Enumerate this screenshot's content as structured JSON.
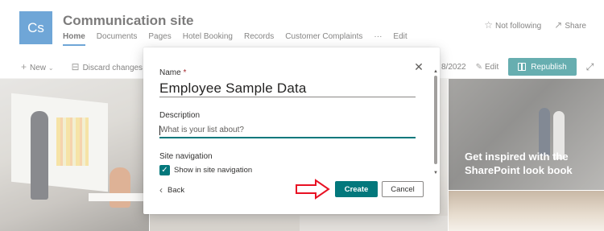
{
  "site": {
    "logo": "Cs",
    "title": "Communication site",
    "nav": [
      "Home",
      "Documents",
      "Pages",
      "Hotel Booking",
      "Records",
      "Customer Complaints",
      "···",
      "Edit"
    ],
    "not_following": "Not following",
    "share": "Share"
  },
  "commandbar": {
    "new": "New",
    "discard": "Discard changes",
    "date_fragment": "8/2022",
    "edit": "Edit",
    "republish": "Republish"
  },
  "hero": {
    "inspire_text": "Get inspired with the SharePoint look book"
  },
  "dialog": {
    "name_label": "Name",
    "required_mark": "*",
    "name_value": "Employee Sample Data",
    "description_label": "Description",
    "description_placeholder": "What is your list about?",
    "site_navigation_label": "Site navigation",
    "show_in_nav": "Show in site navigation",
    "show_in_nav_checked": true,
    "back": "Back",
    "create": "Create",
    "cancel": "Cancel"
  },
  "colors": {
    "accent": "#03787c",
    "logo_bg": "#0f6cbd",
    "arrow": "#e81123"
  },
  "icons": [
    "star-icon",
    "share-icon",
    "plus-icon",
    "discard-icon",
    "pencil-icon",
    "republish-icon",
    "expand-icon",
    "close-icon",
    "checkmark-icon",
    "chevron-left-icon",
    "red-arrow-annotation"
  ]
}
